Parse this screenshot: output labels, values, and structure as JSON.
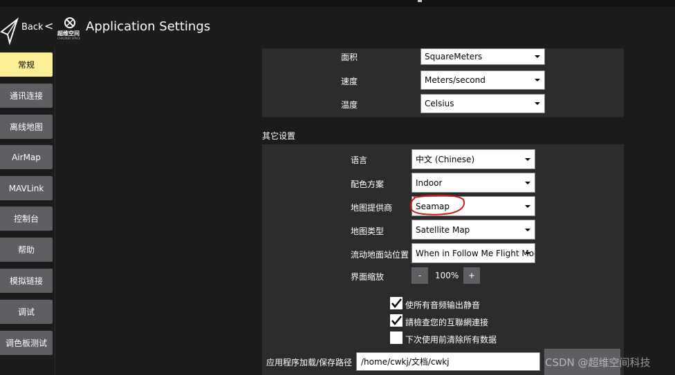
{
  "header": {
    "back_label": "Back",
    "lt": "<",
    "logo_text": "超维空间",
    "logo_sub": "CHAOWEI SPACE",
    "title": "Application Settings"
  },
  "sidebar": {
    "items": [
      {
        "label": "常规",
        "active": true
      },
      {
        "label": "通讯连接"
      },
      {
        "label": "离线地图"
      },
      {
        "label": "AirMap"
      },
      {
        "label": "MAVLink"
      },
      {
        "label": "控制台"
      },
      {
        "label": "帮助"
      },
      {
        "label": "模拟链接"
      },
      {
        "label": "调试"
      },
      {
        "label": "调色板测试"
      }
    ]
  },
  "units": {
    "area_label": "面积",
    "area_value": "SquareMeters",
    "speed_label": "速度",
    "speed_value": "Meters/second",
    "temp_label": "温度",
    "temp_value": "Celsius"
  },
  "other": {
    "section_title": "其它设置",
    "language_label": "语言",
    "language_value": "中文 (Chinese)",
    "color_scheme_label": "配色方案",
    "color_scheme_value": "Indoor",
    "map_provider_label": "地图提供商",
    "map_provider_value": "Seamap",
    "map_type_label": "地图类型",
    "map_type_value": "Satellite Map",
    "gcs_position_label": "流动地面站位置",
    "gcs_position_value": "When in Follow Me Flight Mode",
    "ui_scale_label": "界面缩放",
    "ui_scale_minus": "-",
    "ui_scale_value": "100%",
    "ui_scale_plus": "+",
    "mute_label": "使所有音频输出静音",
    "check_internet_label": "請檢查您的互聯網連接",
    "clear_label": "下次使用前清除所有数据",
    "path_label": "应用程序加载/保存路径",
    "path_value": "/home/cwkj/文档/cwkj"
  },
  "watermark": "CSDN @超维空间科技",
  "colors": {
    "active_tab": "#fdef96",
    "button_gray": "#5f5f63",
    "panel": "#2c2c2c",
    "annotation": "#d0161b"
  }
}
